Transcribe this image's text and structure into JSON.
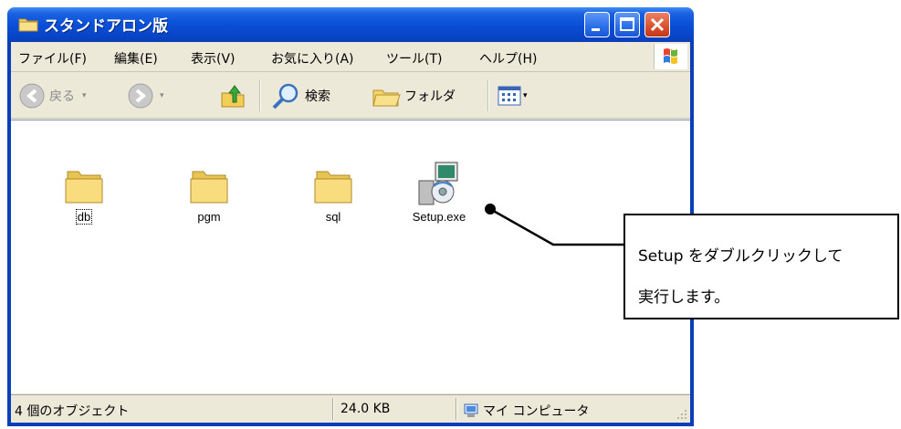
{
  "window": {
    "title": "スタンドアロン版"
  },
  "menu": {
    "items": [
      "ファイル(F)",
      "編集(E)",
      "表示(V)",
      "お気に入り(A)",
      "ツール(T)",
      "ヘルプ(H)"
    ]
  },
  "toolbar": {
    "back_label": "戻る",
    "search_label": "検索",
    "folders_label": "フォルダ"
  },
  "files": [
    {
      "name": "db",
      "icon": "folder-icon"
    },
    {
      "name": "pgm",
      "icon": "folder-icon"
    },
    {
      "name": "sql",
      "icon": "folder-icon"
    },
    {
      "name": "Setup.exe",
      "icon": "setup-exe-icon"
    }
  ],
  "statusbar": {
    "object_count": "4 個のオブジェクト",
    "size": "24.0 KB",
    "location": "マイ コンピュータ"
  },
  "callout": {
    "line1": "Setup をダブルクリックして",
    "line2": "実行します。"
  },
  "colors": {
    "titlebar": "#0a4fd8",
    "window_face": "#ece9d8",
    "close_button": "#d9512b"
  }
}
